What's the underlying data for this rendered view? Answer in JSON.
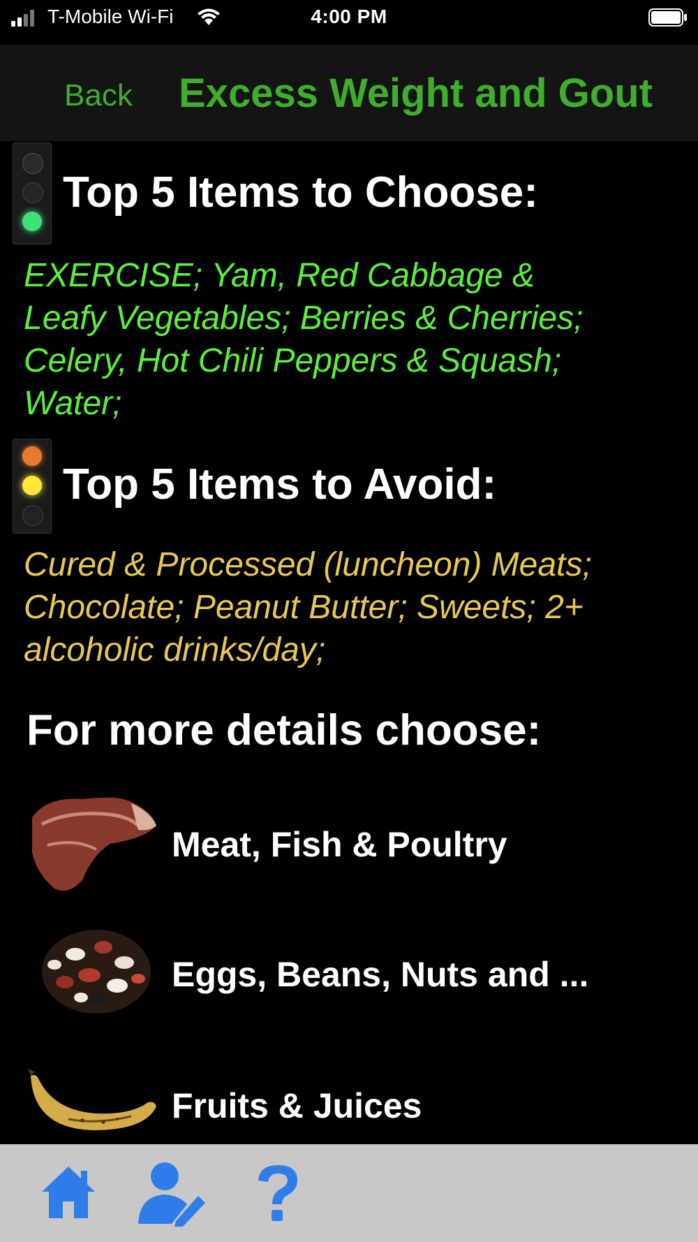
{
  "status_bar": {
    "carrier": "T-Mobile Wi-Fi",
    "time": "4:00 PM"
  },
  "nav": {
    "back_label": "Back",
    "title": "Excess Weight and Gout"
  },
  "choose_section": {
    "heading": "Top 5 Items to Choose:",
    "lines": [
      "EXERCISE; Yam, Red Cabbage &",
      "Leafy Vegetables; Berries & Cherries;",
      "Celery, Hot Chili Peppers & Squash;",
      "Water;"
    ],
    "light_icon": "green-traffic-light-icon",
    "text_color": "#5cf03c"
  },
  "avoid_section": {
    "heading": "Top 5 Items to Avoid:",
    "lines": [
      "Cured & Processed (luncheon) Meats;",
      "Chocolate; Peanut Butter; Sweets; 2+",
      "alcoholic drinks/day;"
    ],
    "light_icon": "yellow-traffic-light-icon",
    "text_color": "#e9c855"
  },
  "details": {
    "heading": "For more details choose:",
    "items": [
      {
        "label": "Meat, Fish & Poultry",
        "icon": "steak-icon"
      },
      {
        "label": "Eggs, Beans, Nuts and ...",
        "icon": "beans-icon"
      },
      {
        "label": "Fruits & Juices",
        "icon": "banana-icon"
      }
    ]
  },
  "tab_bar": {
    "tabs": [
      {
        "icon": "home-icon"
      },
      {
        "icon": "user-edit-icon"
      },
      {
        "icon": "help-icon"
      }
    ],
    "accent_color": "#2f7de8"
  },
  "colors": {
    "title_green": "#3fae2a",
    "background": "#000000",
    "tab_bar_bg": "#c8c8c8"
  }
}
